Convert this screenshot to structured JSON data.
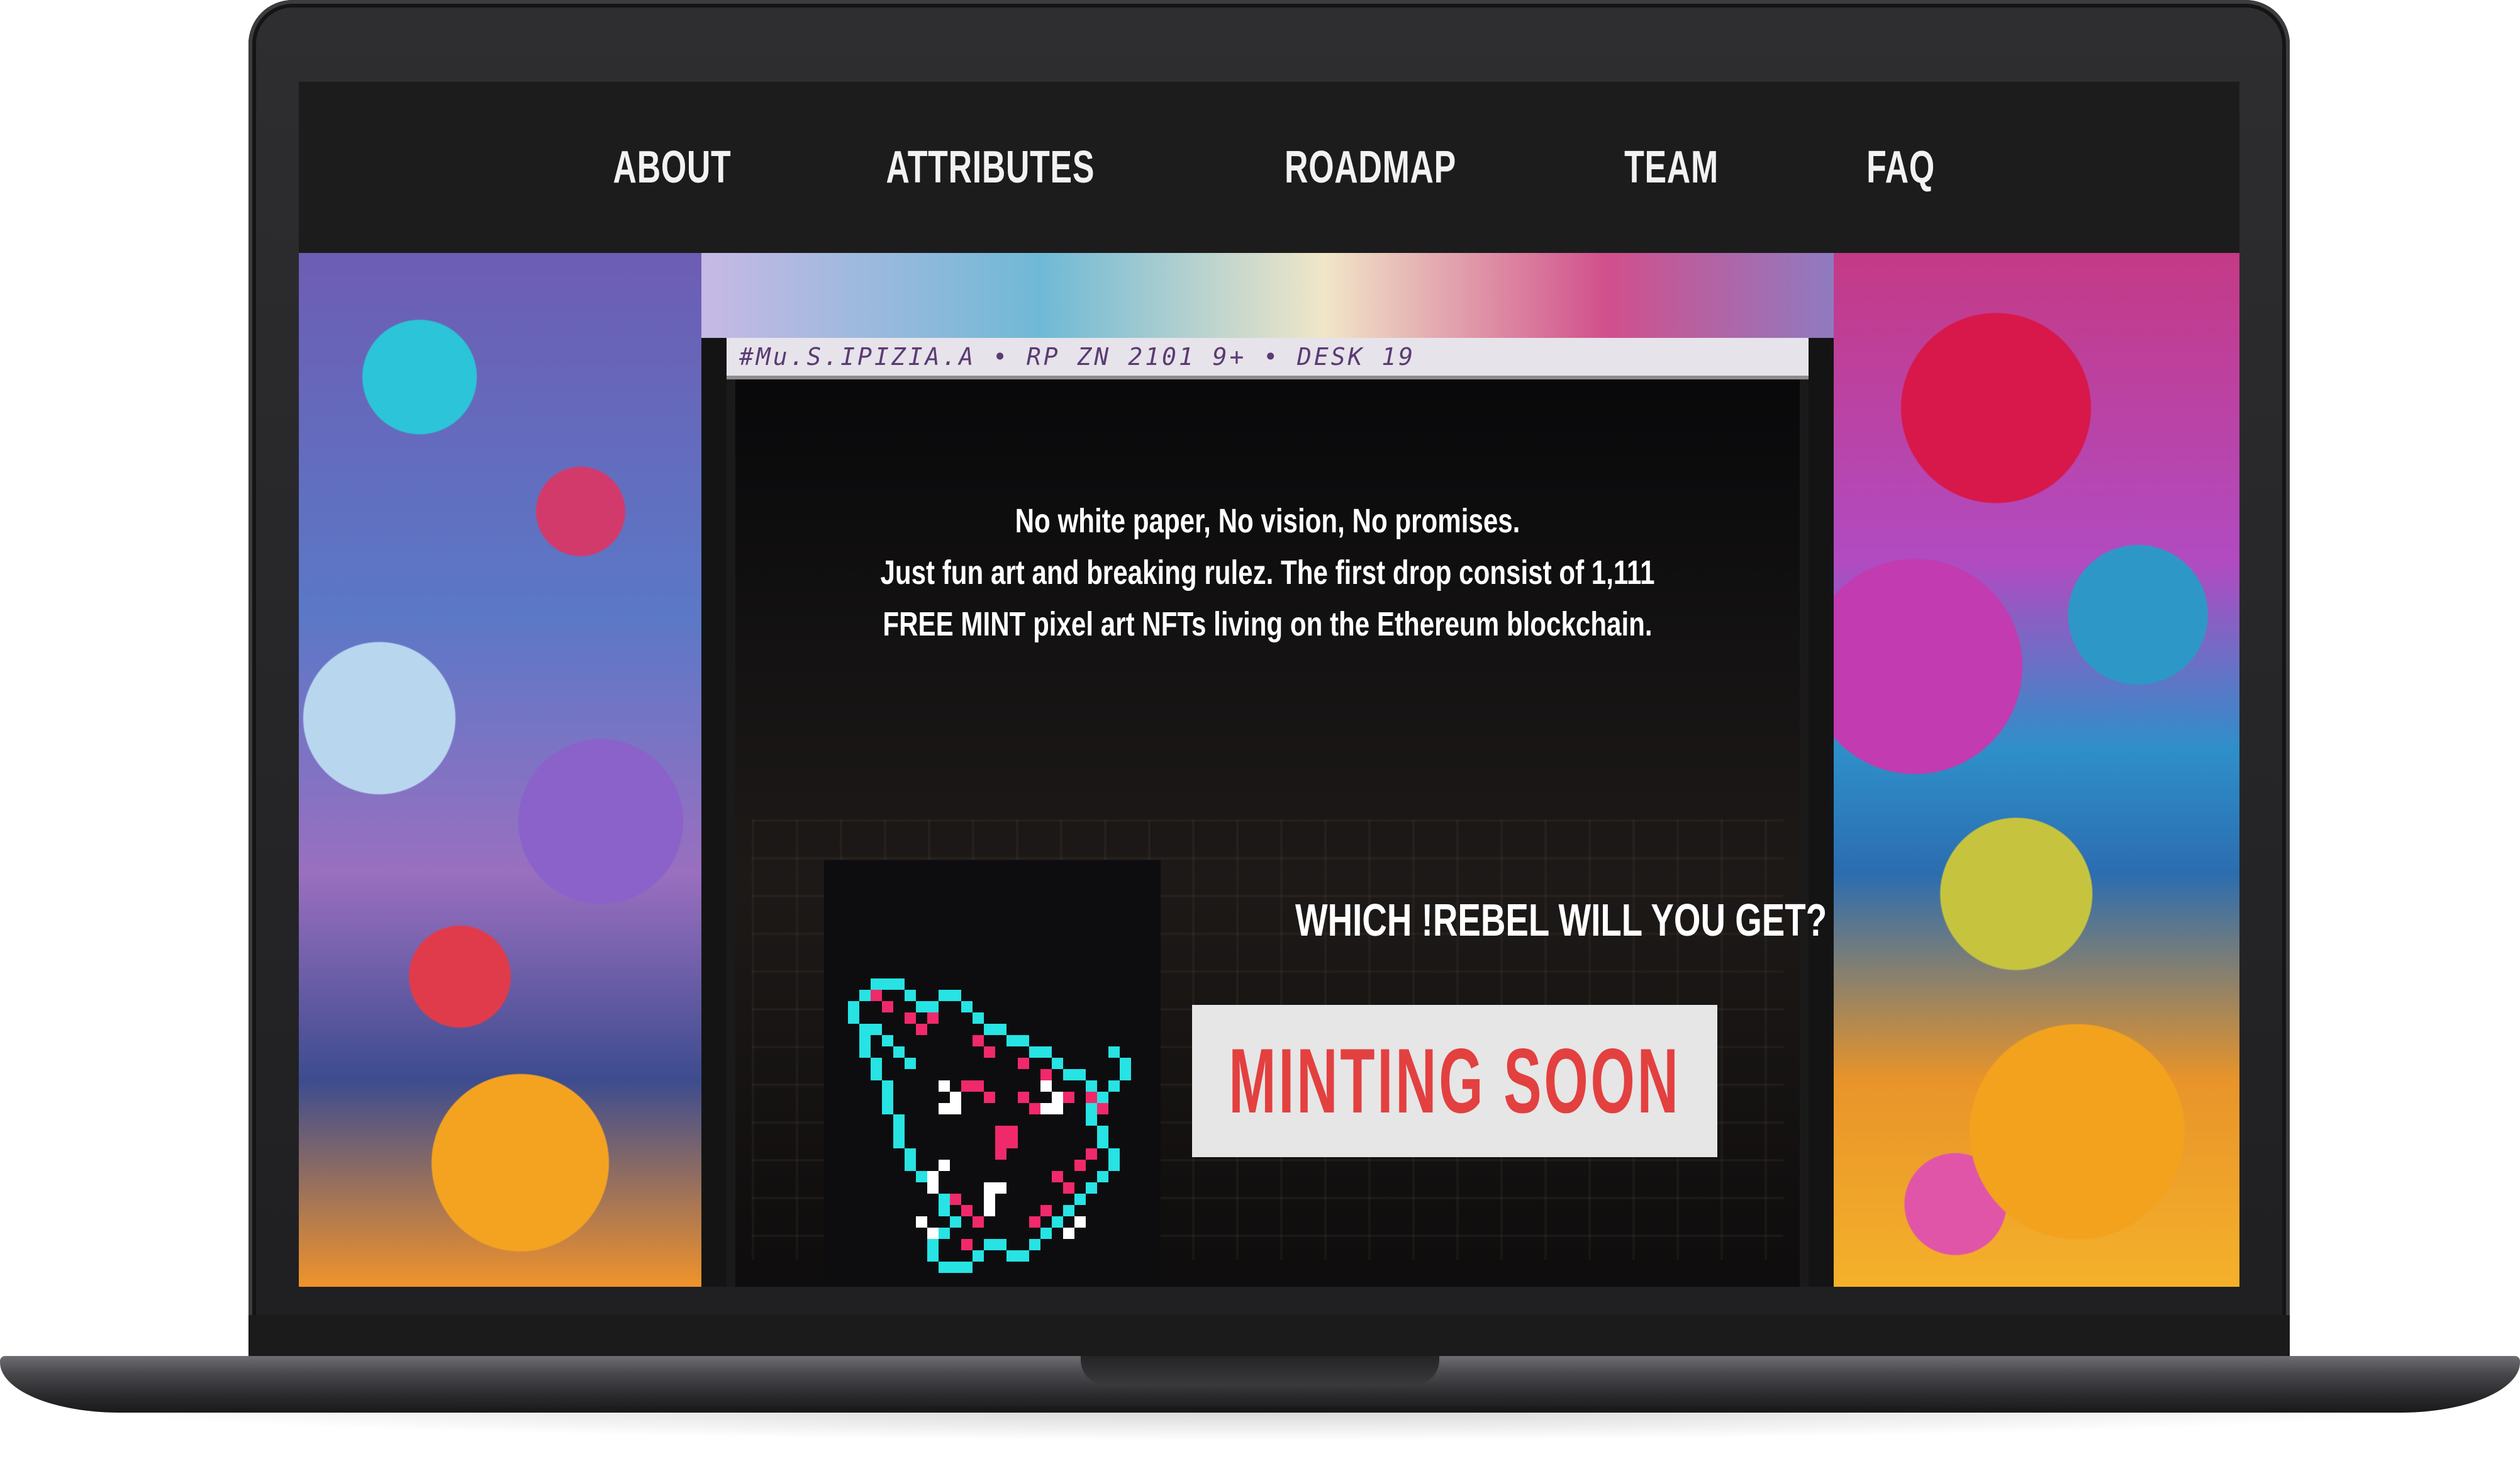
{
  "nav": {
    "items": [
      {
        "label": "ABOUT"
      },
      {
        "label": "ATTRIBUTES"
      },
      {
        "label": "ROADMAP"
      },
      {
        "label": "TEAM"
      },
      {
        "label": "FAQ"
      }
    ]
  },
  "hero": {
    "intro_lines": [
      "No white paper, No vision, No promises.",
      "Just fun art and breaking rulez. The first drop consist of 1,111",
      "FREE MINT pixel art NFTs living on the Ethereum blockchain."
    ],
    "question": "WHICH !REBEL WILL YOU GET?",
    "mint_button_label": "MINTING SOON",
    "graffiti_tag": "#Mu.S.IPIZIA.A • RP ZN 2101 9+ • DESK 19"
  },
  "colors": {
    "nav_background": "#1c1c1d",
    "accent_red": "#e34040",
    "button_background": "#e6e6e6",
    "pixel_cyan": "#27e3e3",
    "pixel_pink": "#f0296b"
  },
  "icons": {
    "rebel_character": "pixel-cat-rebel-icon"
  }
}
